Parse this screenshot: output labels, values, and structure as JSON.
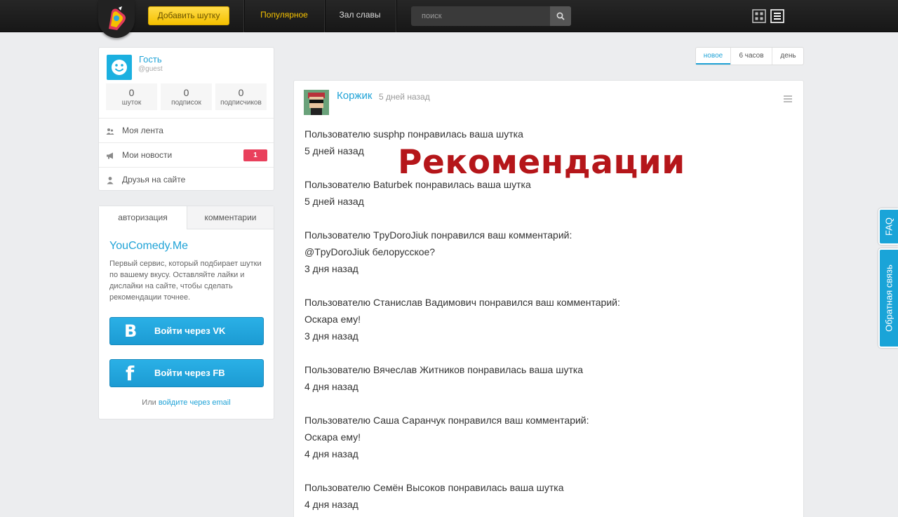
{
  "topbar": {
    "add_button": "Добавить шутку",
    "nav": [
      {
        "label": "Популярное",
        "active": true
      },
      {
        "label": "Зал славы",
        "active": false
      }
    ],
    "search_placeholder": "поиск"
  },
  "profile": {
    "name": "Гость",
    "handle": "@guest",
    "stats": [
      {
        "value": "0",
        "label": "шуток"
      },
      {
        "value": "0",
        "label": "подписок"
      },
      {
        "value": "0",
        "label": "подписчиков"
      }
    ],
    "menu": [
      {
        "label": "Моя лента"
      },
      {
        "label": "Мои новости",
        "badge": "1"
      },
      {
        "label": "Друзья на сайте"
      }
    ]
  },
  "auth": {
    "tabs": [
      "авторизация",
      "комментарии"
    ],
    "brand": "YouComedy.Me",
    "description": "Первый сервис, который подбирает шутки по вашему вкусу. Оставляйте лайки и дислайки на сайте, чтобы сделать рекомендации точнее.",
    "vk_button": "Войти через VK",
    "fb_button": "Войти через FB",
    "alt_prefix": "Или",
    "alt_link": "войдите через email"
  },
  "filters": [
    "новое",
    "6 часов",
    "день"
  ],
  "post": {
    "author": "Коржик",
    "time": "5 дней назад",
    "lines": [
      "Пользователю susphp понравилась ваша шутка",
      "5 дней назад",
      "",
      "Пользователю Baturbek понравилась ваша шутка",
      "5 дней назад",
      "",
      "Пользователю TpyDoroJiuk понравился ваш комментарий:",
      "@TpyDoroJiuk белорусское?",
      "3 дня назад",
      "",
      "Пользователю Станислав Вадимович понравился ваш комментарий:",
      "Оскара ему!",
      "3 дня назад",
      "",
      "Пользователю Вячеслав Житников понравилась ваша шутка",
      "4 дня назад",
      "",
      "Пользователю Саша Саранчук понравился ваш комментарий:",
      "Оскара ему!",
      "4 дня назад",
      "",
      "Пользователю Семён Высоков понравилась ваша шутка",
      "4 дня назад"
    ]
  },
  "overlay_title": "Рекомендации",
  "side_tabs": [
    "FAQ",
    "Обратная связь"
  ],
  "colors": {
    "accent": "#20a3d7",
    "brand_yellow": "#f5c200",
    "badge": "#e9405c",
    "overlay": "#b5161a"
  }
}
